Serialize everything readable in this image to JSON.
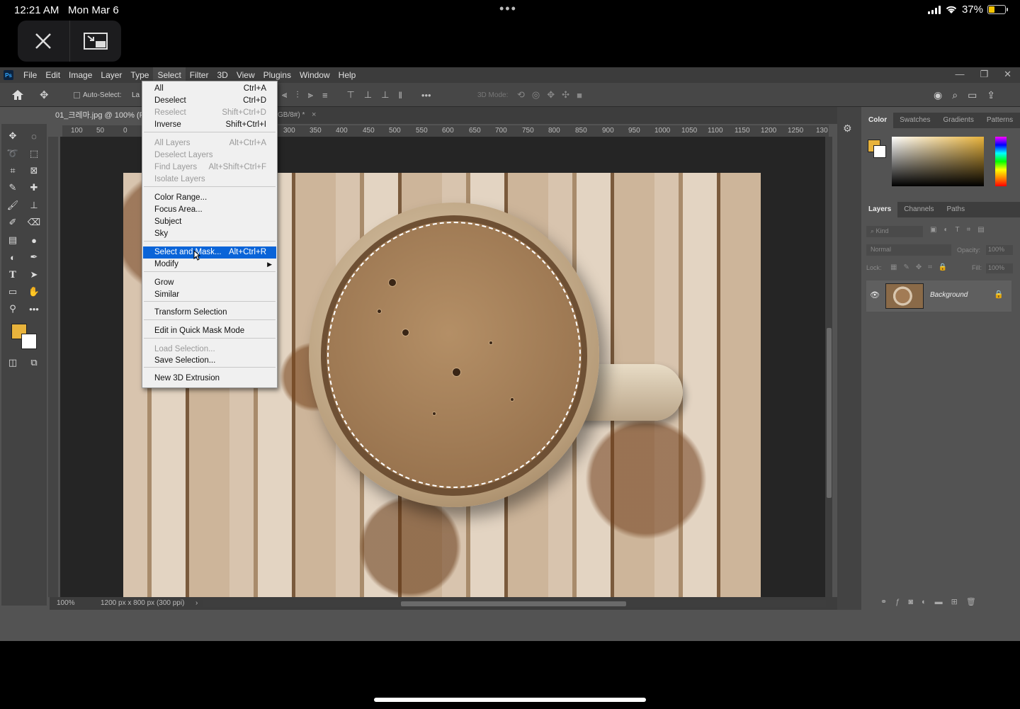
{
  "status_bar": {
    "time": "12:21 AM",
    "date": "Mon Mar 6",
    "battery": "37%",
    "battery_level": 0.37
  },
  "app_menu": [
    "File",
    "Edit",
    "Image",
    "Layer",
    "Type",
    "Select",
    "Filter",
    "3D",
    "View",
    "Plugins",
    "Window",
    "Help"
  ],
  "options_bar": {
    "auto_select": "Auto-Select:",
    "layer_abbrev": "La",
    "mode_3d": "3D Mode:"
  },
  "document": {
    "tab_title": "01_크레마.jpg @ 100% (R",
    "tab_title_tail": "GB/8#) *",
    "zoom": "100%",
    "info": "1200 px x 800 px (300 ppi)"
  },
  "ruler": {
    "h_ticks": [
      "100",
      "50",
      "0",
      "300",
      "350",
      "400",
      "450",
      "500",
      "550",
      "600",
      "650",
      "700",
      "750",
      "800",
      "850",
      "900",
      "950",
      "1000",
      "1050",
      "1100",
      "1150",
      "1200",
      "1250",
      "130"
    ]
  },
  "color_panel": {
    "tabs": [
      "Color",
      "Swatches",
      "Gradients",
      "Patterns"
    ],
    "foreground": "#e8b33c",
    "background": "#ffffff"
  },
  "layers_panel": {
    "tabs": [
      "Layers",
      "Channels",
      "Paths"
    ],
    "kind": "Kind",
    "blend": "Normal",
    "opacity_label": "Opacity:",
    "opacity": "100%",
    "lock_label": "Lock:",
    "fill_label": "Fill:",
    "fill": "100%",
    "layer_name": "Background"
  },
  "select_menu": {
    "items": [
      {
        "label": "All",
        "shortcut": "Ctrl+A",
        "disabled": false
      },
      {
        "label": "Deselect",
        "shortcut": "Ctrl+D",
        "disabled": false
      },
      {
        "label": "Reselect",
        "shortcut": "Shift+Ctrl+D",
        "disabled": true
      },
      {
        "label": "Inverse",
        "shortcut": "Shift+Ctrl+I",
        "disabled": false
      },
      {
        "label": "All Layers",
        "shortcut": "Alt+Ctrl+A",
        "disabled": true
      },
      {
        "label": "Deselect Layers",
        "shortcut": "",
        "disabled": true
      },
      {
        "label": "Find Layers",
        "shortcut": "Alt+Shift+Ctrl+F",
        "disabled": true
      },
      {
        "label": "Isolate Layers",
        "shortcut": "",
        "disabled": true
      },
      {
        "label": "Color Range...",
        "shortcut": "",
        "disabled": false
      },
      {
        "label": "Focus Area...",
        "shortcut": "",
        "disabled": false
      },
      {
        "label": "Subject",
        "shortcut": "",
        "disabled": false
      },
      {
        "label": "Sky",
        "shortcut": "",
        "disabled": false
      },
      {
        "label": "Select and Mask...",
        "shortcut": "Alt+Ctrl+R",
        "disabled": false
      },
      {
        "label": "Modify",
        "shortcut": "",
        "disabled": false
      },
      {
        "label": "Grow",
        "shortcut": "",
        "disabled": false
      },
      {
        "label": "Similar",
        "shortcut": "",
        "disabled": false
      },
      {
        "label": "Transform Selection",
        "shortcut": "",
        "disabled": false
      },
      {
        "label": "Edit in Quick Mask Mode",
        "shortcut": "",
        "disabled": false
      },
      {
        "label": "Load Selection...",
        "shortcut": "",
        "disabled": true
      },
      {
        "label": "Save Selection...",
        "shortcut": "",
        "disabled": false
      },
      {
        "label": "New 3D Extrusion",
        "shortcut": "",
        "disabled": false
      }
    ],
    "highlighted": "Select and Mask..."
  }
}
